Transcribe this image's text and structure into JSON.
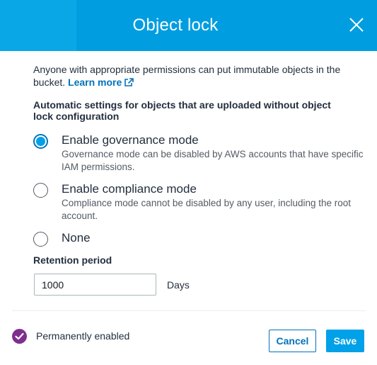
{
  "dialog": {
    "title": "Object lock",
    "close_icon": "close-icon"
  },
  "intro": {
    "text": "Anyone with appropriate permissions can put immutable objects in the bucket.",
    "learn_more": "Learn more",
    "learn_more_icon": "external-link-icon"
  },
  "settings": {
    "heading": "Automatic settings for objects that are uploaded without object lock configuration",
    "options": [
      {
        "label": "Enable governance mode",
        "description": "Governance mode can be disabled by AWS accounts that have specific IAM permissions.",
        "selected": true
      },
      {
        "label": "Enable compliance mode",
        "description": "Compliance mode cannot be disabled by any user, including the root account.",
        "selected": false
      },
      {
        "label": "None",
        "description": "",
        "selected": false
      }
    ]
  },
  "retention": {
    "label": "Retention period",
    "value": "1000",
    "unit": "Days"
  },
  "footer": {
    "status_icon": "check-circle-icon",
    "status_text": "Permanently enabled",
    "cancel_label": "Cancel",
    "save_label": "Save"
  },
  "colors": {
    "header": "#009ee0",
    "accent": "#0073bb",
    "status_badge": "#7e2f8e"
  }
}
